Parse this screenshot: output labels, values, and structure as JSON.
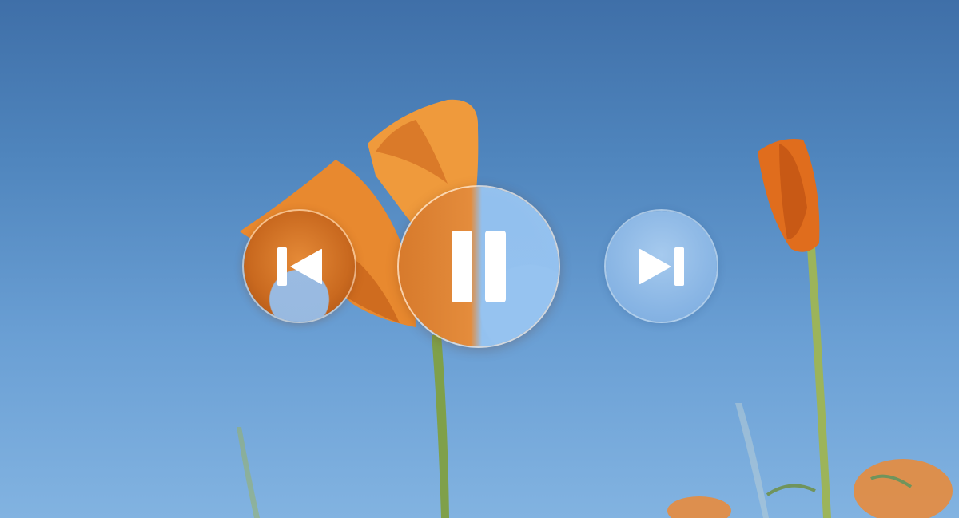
{
  "player": {
    "state": "playing",
    "controls": [
      {
        "id": "previous",
        "icon": "skip-back-icon"
      },
      {
        "id": "play_pause",
        "icon": "pause-icon"
      },
      {
        "id": "next",
        "icon": "skip-forward-icon"
      }
    ]
  },
  "colors": {
    "sky_top": "#3f6fa8",
    "sky_bottom": "#82b3e1",
    "petal": "#e8892f",
    "petal_dark": "#c45f18",
    "stem": "#7fa04a",
    "icon": "#ffffff"
  }
}
